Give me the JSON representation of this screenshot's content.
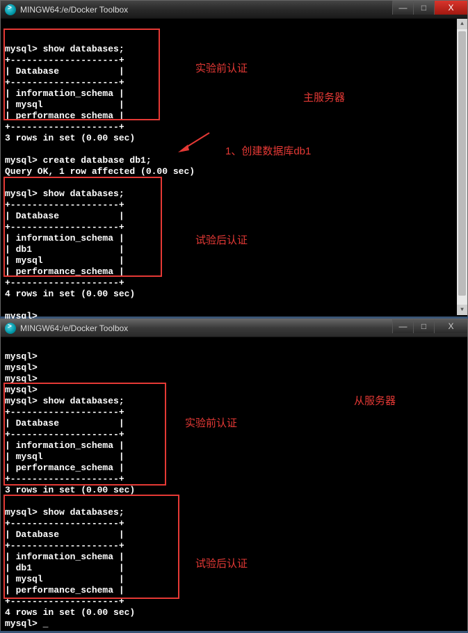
{
  "windows": [
    {
      "title": "MINGW64:/e/Docker Toolbox",
      "controls": {
        "min": "—",
        "max": "□",
        "close": "X"
      }
    },
    {
      "title": "MINGW64:/e/Docker Toolbox",
      "controls": {
        "min": "—",
        "max": "□",
        "close": "X"
      }
    }
  ],
  "top_terminal": {
    "cmd1": "mysql> show databases;",
    "sep": "+--------------------+",
    "header": "| Database           |",
    "row_info": "| information_schema |",
    "row_mysql": "| mysql              |",
    "row_perf": "| performance_schema |",
    "result1": "3 rows in set (0.00 sec)",
    "blank": "",
    "cmd2": "mysql> create database db1;",
    "result2": "Query OK, 1 row affected (0.00 sec)",
    "cmd3": "mysql> show databases;",
    "row_db1": "| db1                |",
    "result3": "4 rows in set (0.00 sec)",
    "prompt": "mysql>"
  },
  "bottom_terminal": {
    "prompt": "mysql>",
    "cmd1": "mysql> show databases;",
    "sep": "+--------------------+",
    "header": "| Database           |",
    "row_info": "| information_schema |",
    "row_mysql": "| mysql              |",
    "row_perf": "| performance_schema |",
    "row_db1": "| db1                |",
    "result1": "3 rows in set (0.00 sec)",
    "result2": "4 rows in set (0.00 sec)",
    "prompt_cursor": "mysql> _"
  },
  "annotations": {
    "a1": "实验前认证",
    "a2": "主服务器",
    "a3": "1、创建数据库db1",
    "a4": "试验后认证",
    "a5": "从服务器",
    "a6": "实验前认证",
    "a7": "试验后认证"
  }
}
